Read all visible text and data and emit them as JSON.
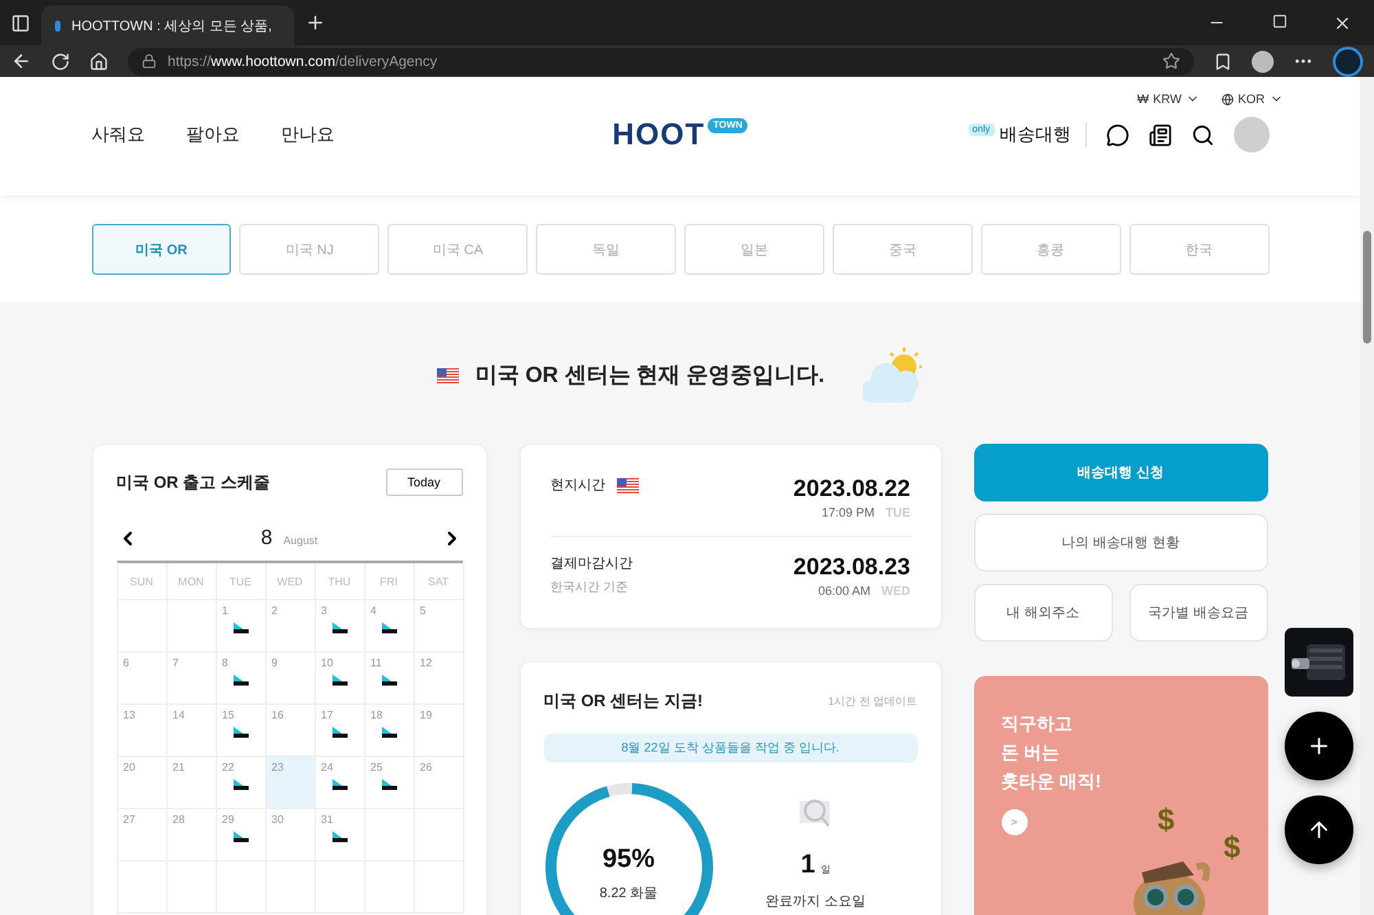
{
  "browser": {
    "tab_title": "HOOTTOWN : 세상의 모든 상품,",
    "url": "https://**www.hoottown.com**/deliveryAgency"
  },
  "header": {
    "currency_symbol": "₩",
    "currency": "KRW",
    "language": "KOR",
    "nav": [
      "사줘요",
      "팔아요",
      "만나요"
    ],
    "logo": {
      "main": "HOOT",
      "badge": "TOWN"
    },
    "service_badge": "only",
    "service": "배송대행"
  },
  "centers": [
    {
      "label": "미국 OR",
      "selected": true
    },
    {
      "label": "미국 NJ",
      "selected": false
    },
    {
      "label": "미국 CA",
      "selected": false
    },
    {
      "label": "독일",
      "selected": false
    },
    {
      "label": "일본",
      "selected": false
    },
    {
      "label": "중국",
      "selected": false
    },
    {
      "label": "홍콩",
      "selected": false
    },
    {
      "label": "한국",
      "selected": false
    }
  ],
  "status": {
    "message": "미국 OR 센터는 현재 운영중입니다."
  },
  "schedule": {
    "title": "미국 OR 출고 스케줄",
    "today_button": "Today",
    "month": "8",
    "month_name": "August",
    "weekdays": [
      "SUN",
      "MON",
      "TUE",
      "WED",
      "THU",
      "FRI",
      "SAT"
    ],
    "weeks": [
      [
        {
          "kind": "empty"
        },
        {
          "kind": "empty"
        },
        {
          "kind": "day",
          "day": "1",
          "shipping": true,
          "selected": false
        },
        {
          "kind": "day",
          "day": "2",
          "shipping": false,
          "selected": false
        },
        {
          "kind": "day",
          "day": "3",
          "shipping": true,
          "selected": false
        },
        {
          "kind": "day",
          "day": "4",
          "shipping": true,
          "selected": false
        },
        {
          "kind": "day",
          "day": "5",
          "shipping": false,
          "selected": false
        }
      ],
      [
        {
          "kind": "day",
          "day": "6",
          "shipping": false,
          "selected": false
        },
        {
          "kind": "day",
          "day": "7",
          "shipping": false,
          "selected": false
        },
        {
          "kind": "day",
          "day": "8",
          "shipping": true,
          "selected": false
        },
        {
          "kind": "day",
          "day": "9",
          "shipping": false,
          "selected": false
        },
        {
          "kind": "day",
          "day": "10",
          "shipping": true,
          "selected": false
        },
        {
          "kind": "day",
          "day": "11",
          "shipping": true,
          "selected": false
        },
        {
          "kind": "day",
          "day": "12",
          "shipping": false,
          "selected": false
        }
      ],
      [
        {
          "kind": "day",
          "day": "13",
          "shipping": false,
          "selected": false
        },
        {
          "kind": "day",
          "day": "14",
          "shipping": false,
          "selected": false
        },
        {
          "kind": "day",
          "day": "15",
          "shipping": true,
          "selected": false
        },
        {
          "kind": "day",
          "day": "16",
          "shipping": false,
          "selected": false
        },
        {
          "kind": "day",
          "day": "17",
          "shipping": true,
          "selected": false
        },
        {
          "kind": "day",
          "day": "18",
          "shipping": true,
          "selected": false
        },
        {
          "kind": "day",
          "day": "19",
          "shipping": false,
          "selected": false
        }
      ],
      [
        {
          "kind": "day",
          "day": "20",
          "shipping": false,
          "selected": false
        },
        {
          "kind": "day",
          "day": "21",
          "shipping": false,
          "selected": false
        },
        {
          "kind": "day",
          "day": "22",
          "shipping": true,
          "selected": false
        },
        {
          "kind": "day",
          "day": "23",
          "shipping": false,
          "selected": true
        },
        {
          "kind": "day",
          "day": "24",
          "shipping": true,
          "selected": false
        },
        {
          "kind": "day",
          "day": "25",
          "shipping": true,
          "selected": false
        },
        {
          "kind": "day",
          "day": "26",
          "shipping": false,
          "selected": false
        }
      ],
      [
        {
          "kind": "day",
          "day": "27",
          "shipping": false,
          "selected": false
        },
        {
          "kind": "day",
          "day": "28",
          "shipping": false,
          "selected": false
        },
        {
          "kind": "day",
          "day": "29",
          "shipping": true,
          "selected": false
        },
        {
          "kind": "day",
          "day": "30",
          "shipping": false,
          "selected": false
        },
        {
          "kind": "day",
          "day": "31",
          "shipping": true,
          "selected": false
        },
        {
          "kind": "empty"
        },
        {
          "kind": "empty"
        }
      ],
      [
        {
          "kind": "empty"
        },
        {
          "kind": "empty"
        },
        {
          "kind": "empty"
        },
        {
          "kind": "empty"
        },
        {
          "kind": "empty"
        },
        {
          "kind": "empty"
        },
        {
          "kind": "empty"
        }
      ]
    ]
  },
  "time_card": {
    "rows": [
      {
        "label": "현지시간",
        "flag": true,
        "date": "2023.08.22",
        "time": "17:09 PM",
        "weekday": "TUE"
      },
      {
        "label": "결제마감시간",
        "note": "한국시간 기준",
        "flag": false,
        "date": "2023.08.23",
        "time": "06:00 AM",
        "weekday": "WED"
      }
    ]
  },
  "status_card": {
    "title": "미국 OR 센터는 지금!",
    "updated": "1시간 전 업데이트",
    "notice": "8월 22일 도착 상품들을 작업 중 입니다.",
    "progress": {
      "value": "95%",
      "caption": "8.22 화물"
    },
    "duration": {
      "value": "1",
      "unit": "일",
      "caption": "완료까지 소요일"
    }
  },
  "actions": [
    {
      "label": "배송대행 신청",
      "primary": true
    },
    {
      "label": "나의 배송대행 현황",
      "primary": false
    },
    {
      "label": "내 해외주소",
      "primary": false
    },
    {
      "label": "국가별 배송요금",
      "primary": false
    }
  ],
  "promo": {
    "lines": [
      "직구하고",
      "돈 버는",
      "훗타운 매직!"
    ],
    "more": ">",
    "symbols": [
      "$",
      "$"
    ]
  }
}
